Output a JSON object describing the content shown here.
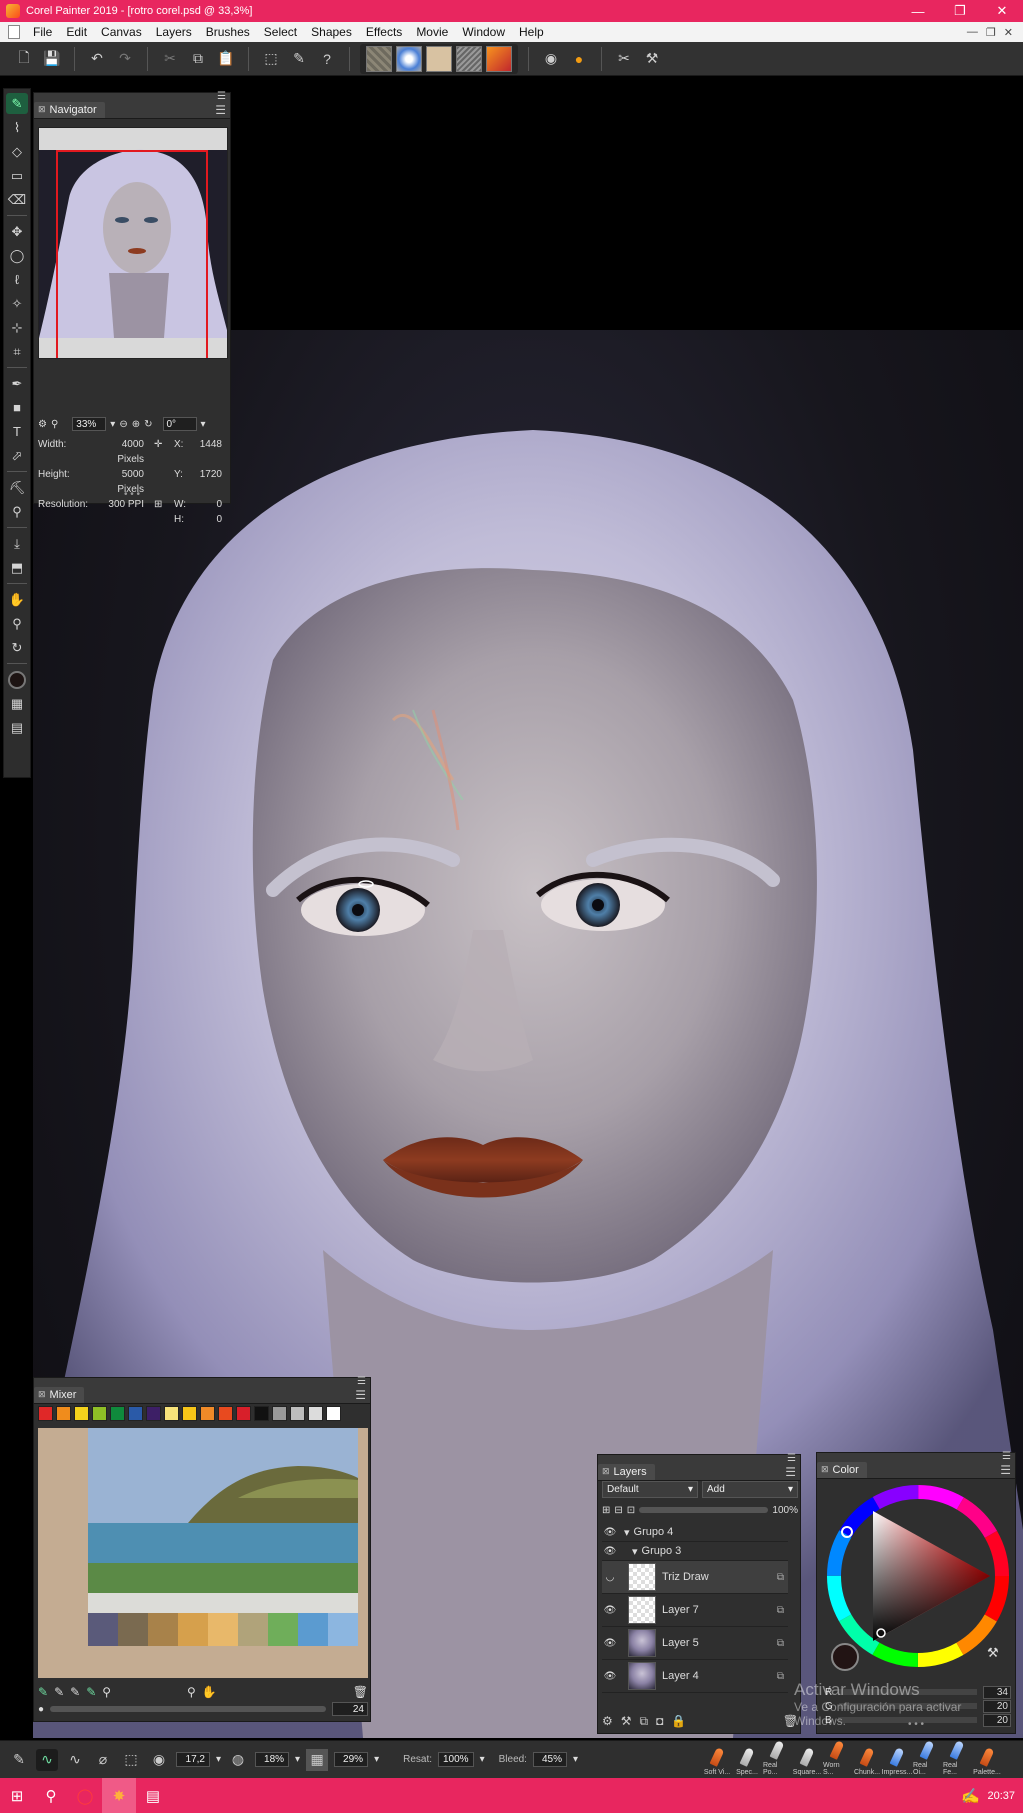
{
  "window": {
    "title": "Corel Painter 2019 - [rotro corel.psd @ 33,3%]",
    "controls": [
      "—",
      "❐",
      "✕"
    ]
  },
  "menu": [
    "File",
    "Edit",
    "Canvas",
    "Layers",
    "Brushes",
    "Select",
    "Shapes",
    "Effects",
    "Movie",
    "Window",
    "Help"
  ],
  "menu_right": [
    "—",
    "❐",
    "✕"
  ],
  "navigator": {
    "tab": "Navigator",
    "zoom": "33%",
    "rotation": "0°",
    "width_label": "Width:",
    "width_value": "4000 Pixels",
    "height_label": "Height:",
    "height_value": "5000 Pixels",
    "resolution_label": "Resolution:",
    "resolution_value": "300 PPI",
    "x_label": "X:",
    "x_value": "1448",
    "y_label": "Y:",
    "y_value": "1720",
    "w_label": "W:",
    "w_value": "0",
    "h_label": "H:",
    "h_value": "0"
  },
  "mixer": {
    "tab": "Mixer",
    "swatches": [
      "#e02828",
      "#f08c1c",
      "#f4d21c",
      "#8fbf26",
      "#0f8a3c",
      "#2a5aa8",
      "#3d1f66",
      "#f7e37a",
      "#f6c518",
      "#f08a28",
      "#e84a1f",
      "#d81f2a",
      "#111111",
      "#9a9a9a",
      "#bdbdbd",
      "#dcdcdc",
      "#ffffff"
    ],
    "brush_size": "24"
  },
  "layers": {
    "tab": "Layers",
    "preset": "Default",
    "composite": "Add",
    "opacity": "100%",
    "items": [
      {
        "name": "Grupo 4",
        "type": "group"
      },
      {
        "name": "Grupo 3",
        "type": "group"
      },
      {
        "name": "Triz Draw",
        "type": "layer"
      },
      {
        "name": "Layer 7",
        "type": "layer"
      },
      {
        "name": "Layer 5",
        "type": "layer"
      },
      {
        "name": "Layer 4",
        "type": "layer"
      }
    ]
  },
  "color": {
    "tab": "Color",
    "r_label": "R",
    "g_label": "G",
    "b_label": "B",
    "r_value": "34",
    "g_value": "20",
    "b_value": "20",
    "current": "#221414"
  },
  "watermark": {
    "line1": "Activar Windows",
    "line2": "Ve a Configuración para activar",
    "line3": "Windows."
  },
  "propbar": {
    "size": "17,2",
    "opacity": "18%",
    "grain": "29%",
    "resat_label": "Resat:",
    "resat_value": "100%",
    "bleed_label": "Bleed:",
    "bleed_value": "45%"
  },
  "brushes": [
    "Soft Vi...",
    "Spec...",
    "Real Po...",
    "Square...",
    "Worn S...",
    "Chunk...",
    "Impress...",
    "Real Oi...",
    "Real Fe...",
    "Palette..."
  ],
  "taskbar": {
    "clock": "20:37"
  }
}
